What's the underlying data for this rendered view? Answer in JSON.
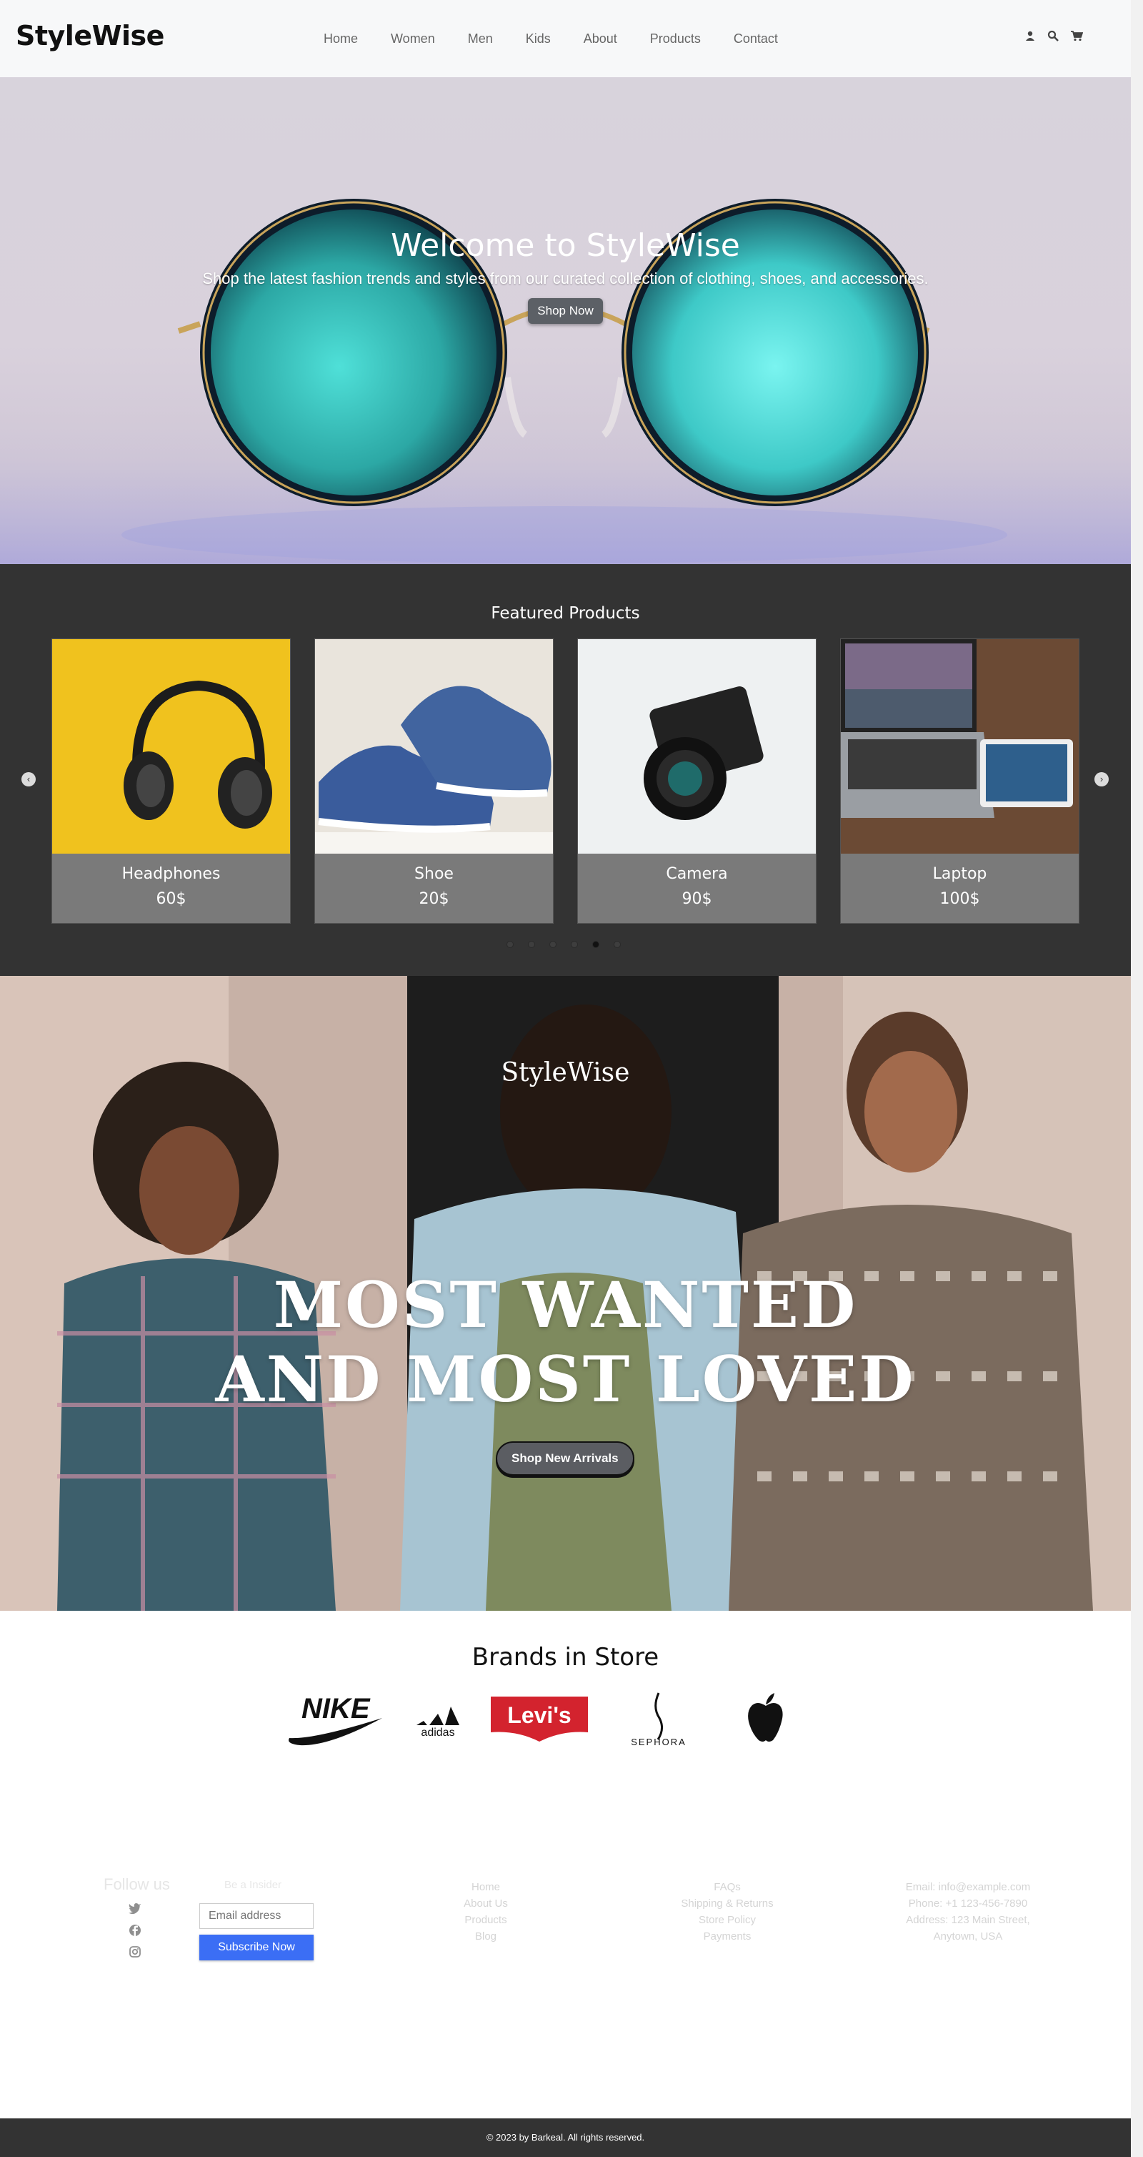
{
  "header": {
    "logo": "StyleWise",
    "nav": [
      "Home",
      "Women",
      "Men",
      "Kids",
      "About",
      "Products",
      "Contact"
    ],
    "icons": [
      "user-icon",
      "search-icon",
      "cart-icon"
    ]
  },
  "hero": {
    "title": "Welcome to StyleWise",
    "subtitle": "Shop the latest fashion trends and styles from our curated collection of clothing, shoes, and accessories.",
    "button": "Shop Now"
  },
  "featured": {
    "title": "Featured Products",
    "products": [
      {
        "name": "Headphones",
        "price": "60$"
      },
      {
        "name": "Shoe",
        "price": "20$"
      },
      {
        "name": "Camera",
        "price": "90$"
      },
      {
        "name": "Laptop",
        "price": "100$"
      }
    ],
    "dots_count": 6,
    "active_dot": 4
  },
  "banner": {
    "brand": "StyleWise",
    "headline_line1": "MOST WANTED",
    "headline_line2": "AND MOST LOVED",
    "button": "Shop New Arrivals"
  },
  "brands": {
    "title": "Brands in Store",
    "logos": [
      "NIKE",
      "adidas",
      "Levi's",
      "SEPHORA",
      "apple"
    ]
  },
  "footer": {
    "follow_title": "Follow us",
    "insider_title": "Be a Insider",
    "email_placeholder": "Email address",
    "subscribe_button": "Subscribe Now",
    "links_col1": [
      "Home",
      "About Us",
      "Products",
      "Blog"
    ],
    "links_col2": [
      "FAQs",
      "Shipping & Returns",
      "Store Policy",
      "Payments"
    ],
    "contact": [
      "Email: info@example.com",
      "Phone: +1 123-456-7890",
      "Address: 123 Main Street,",
      "Anytown, USA"
    ],
    "copyright": "© 2023 by Barkeal. All rights reserved."
  },
  "colors": {
    "dark_section": "#333333",
    "subscribe_button": "#3b6ef5",
    "card_caption": "#7a7a7a"
  }
}
